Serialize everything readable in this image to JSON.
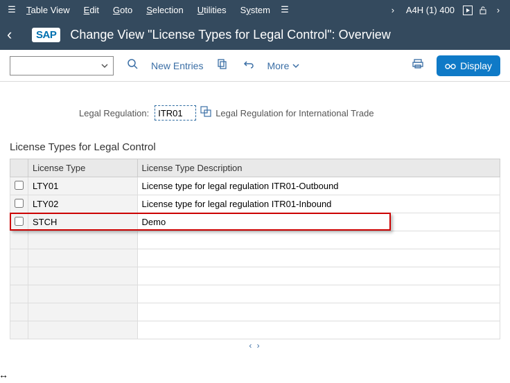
{
  "menubar": {
    "items": [
      "Table View",
      "Edit",
      "Goto",
      "Selection",
      "Utilities",
      "System"
    ],
    "system": "A4H (1) 400"
  },
  "titlebar": {
    "logo": "SAP",
    "title": "Change View \"License Types for Legal Control\": Overview"
  },
  "toolbar": {
    "new_entries": "New Entries",
    "more": "More",
    "display": "Display"
  },
  "field": {
    "label": "Legal Regulation:",
    "value": "ITR01",
    "desc": "Legal Regulation for International Trade"
  },
  "section_title": "License Types for Legal Control",
  "columns": {
    "type": "License Type",
    "desc": "License Type Description"
  },
  "rows": [
    {
      "code": "LTY01",
      "desc": "License type for legal regulation ITR01-Outbound",
      "hl": false
    },
    {
      "code": "LTY02",
      "desc": "License type for legal regulation ITR01-Inbound",
      "hl": false
    },
    {
      "code": "STCH",
      "desc": "Demo",
      "hl": true
    }
  ]
}
